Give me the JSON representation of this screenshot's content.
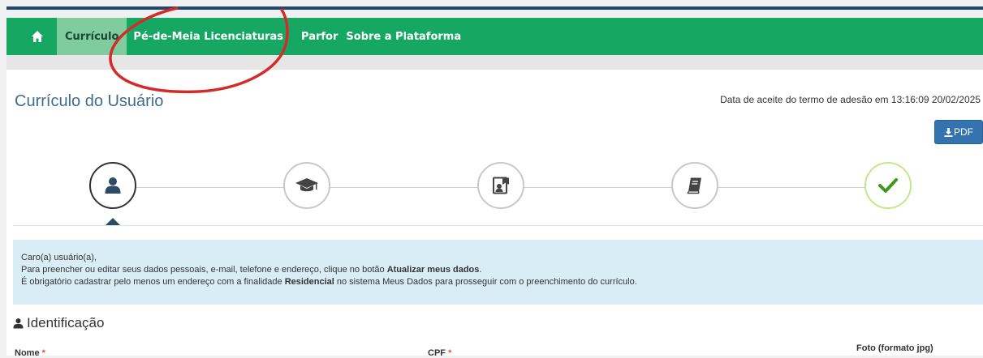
{
  "nav": {
    "home_icon": "home-icon",
    "items": [
      "Currículo",
      "Pé-de-Meia Licenciaturas",
      "Parfor",
      "Sobre a Plataforma"
    ],
    "active_item": "Currículo"
  },
  "header": {
    "title": "Currículo do Usuário",
    "accept_date": "Data de aceite do termo de adesão em 13:16:09 20/02/2025",
    "pdf_label": "PDF"
  },
  "steps": [
    {
      "icon": "user-icon",
      "state": "current"
    },
    {
      "icon": "graduation-cap-icon",
      "state": "pending"
    },
    {
      "icon": "certificate-icon",
      "state": "pending"
    },
    {
      "icon": "book-icon",
      "state": "pending"
    },
    {
      "icon": "check-icon",
      "state": "done"
    }
  ],
  "alert": {
    "greeting": "Caro(a) usuário(a),",
    "line1_pre": "Para preencher ou editar seus dados pessoais, e-mail, telefone e endereço, clique no botão ",
    "line1_bold": "Atualizar meus dados",
    "line1_post": ".",
    "line2_pre": "É obrigatório cadastrar pelo menos um endereço com a finalidade ",
    "line2_bold": "Residencial",
    "line2_post": " no sistema Meus Dados para prosseguir com o preenchimento do currículo."
  },
  "identificacao": {
    "title": "Identificação",
    "nome_label": "Nome",
    "cpf_label": "CPF",
    "required_mark": "*",
    "foto_label": "Foto (formato jpg)"
  },
  "colors": {
    "nav_bg": "#16a862",
    "nav_active": "#7fcc9e",
    "title_blue": "#3f6d8f",
    "pdf_button": "#3573b0",
    "alert_bg": "#d9edf7",
    "check_green": "#3e9a1e",
    "annotation_red": "#d42a2a"
  }
}
